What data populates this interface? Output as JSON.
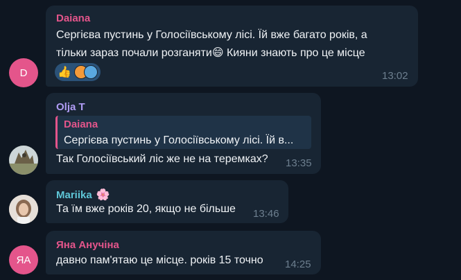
{
  "messages": [
    {
      "sender": "Daiana",
      "sender_color": "#e4558b",
      "avatar_letter": "D",
      "avatar_color": "#e4558b",
      "line1": "Сергієва пустинь у Голосіївському лісі. Їй вже багато років, а",
      "line2_start": "тільки зараз почали розганяти",
      "line2_emoji": "😄",
      "line2_end": " Кияни знають про це місце",
      "reaction_emoji": "👍",
      "time": "13:02"
    },
    {
      "sender": "Olja T",
      "sender_color": "#b09cf5",
      "reply_sender": "Daiana",
      "reply_text": "Сергієва пустинь у Голосіївському лісі. Їй в...",
      "text": "Так Голосіївський ліс же не на теремках?",
      "time": "13:35"
    },
    {
      "sender": "Mariika",
      "sender_color": "#5fc7d8",
      "sender_emoji": "🌸",
      "text": "Та їм вже років 20, якщо не більше",
      "time": "13:46"
    },
    {
      "sender": "Яна Анучіна",
      "sender_color": "#e4558b",
      "avatar_letter": "ЯА",
      "avatar_color": "#e4558b",
      "text": "давно пам'ятаю це місце. років 15 точно",
      "time": "14:25"
    }
  ]
}
